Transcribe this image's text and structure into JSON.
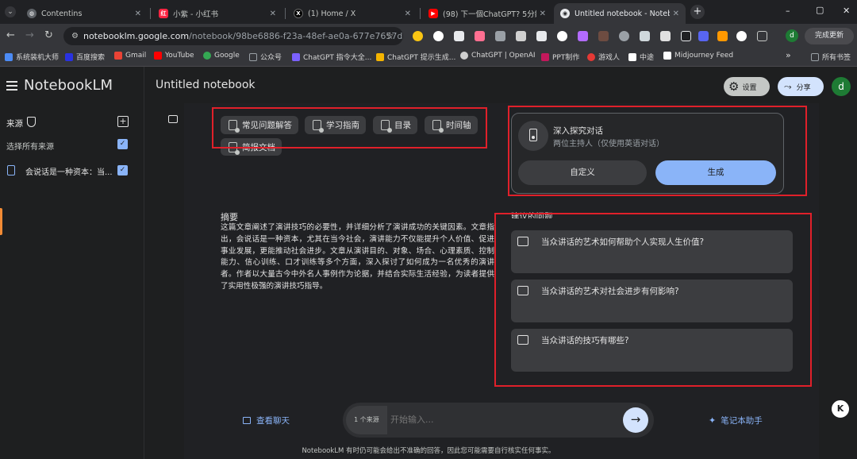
{
  "browser": {
    "tabs": [
      {
        "title": "Contentins",
        "fav": "C",
        "color": "#5f6368"
      },
      {
        "title": "小紫 - 小红书",
        "fav": "红",
        "color": "#ff2442"
      },
      {
        "title": "(1) Home / X",
        "fav": "X",
        "color": "#000000"
      },
      {
        "title": "(98) 下一個ChatGPT? 5分鐘自...",
        "fav": "▶",
        "color": "#ff0000"
      },
      {
        "title": "Untitled notebook - Noteboo",
        "fav": "N",
        "color": "#e8eaed"
      }
    ],
    "new_tab": "+",
    "window_controls": [
      "–",
      "▢",
      "✕"
    ],
    "url_host": "notebooklm.google.com",
    "url_path": "/notebook/98be6886-f23a-48ef-ae0a-677e7657ded...",
    "update_button": "完成更新",
    "profile_letter": "d",
    "bookmarks": [
      {
        "label": "系统装机大师",
        "color": "#4c8bf5"
      },
      {
        "label": "百度搜索",
        "color": "#2932e1"
      },
      {
        "label": "Gmail",
        "color": "#ea4335"
      },
      {
        "label": "YouTube",
        "color": "#ff0000"
      },
      {
        "label": "Google",
        "color": "#34a853"
      },
      {
        "label": "公众号",
        "color": "#9aa0a6"
      },
      {
        "label": "ChatGPT 指令大全...",
        "color": "#7b61ff"
      },
      {
        "label": "ChatGPT 提示生成...",
        "color": "#f4b400"
      },
      {
        "label": "ChatGPT | OpenAI",
        "color": "#cfcfcf"
      },
      {
        "label": "PPT制作",
        "color": "#c2185b"
      },
      {
        "label": "游戏人",
        "color": "#e53935"
      },
      {
        "label": "中途",
        "color": "#ffffff"
      },
      {
        "label": "Midjourney Feed",
        "color": "#ffffff"
      }
    ],
    "more_bookmarks": "»",
    "all_bookmarks": "所有书签"
  },
  "app": {
    "brand": "NotebookLM",
    "notebook_title": "Untitled notebook",
    "settings_label": "设置",
    "share_label": "分享",
    "avatar_letter": "d"
  },
  "sidebar": {
    "sources_title": "来源",
    "select_all": "选择所有来源",
    "source_item": "会说话是一种资本：当..."
  },
  "guide": {
    "chips": [
      "常见问题解答",
      "学习指南",
      "目录",
      "时间轴",
      "简报文档"
    ],
    "summary_title": "摘要",
    "summary_text": "这篇文章阐述了演讲技巧的必要性，并详细分析了演讲成功的关键因素。文章指出，会说话是一种资本，尤其在当今社会，演讲能力不仅能提升个人价值、促进事业发展，更能推动社会进步。文章从演讲目的、对象、场合、心理素质、控制能力、信心训练、口才训练等多个方面，深入探讨了如何成为一名优秀的演讲者。作者以大量古今中外名人事例作为论据，并结合实际生活经验，为读者提供了实用性极强的演讲技巧指导。"
  },
  "audio": {
    "title": "深入探究对话",
    "subtitle": "两位主持人（仅使用英语对话）",
    "customize": "自定义",
    "generate": "生成"
  },
  "suggested": {
    "title": "建议的问题",
    "questions": [
      "当众讲话的艺术如何帮助个人实现人生价值?",
      "当众讲话的艺术对社会进步有何影响?",
      "当众讲话的技巧有哪些?"
    ]
  },
  "bottom": {
    "view_chat": "查看聊天",
    "source_count": "1 个来源",
    "input_placeholder": "开始输入...",
    "notebook_helper": "笔记本助手",
    "disclaimer": "NotebookLM 有时仍可能会给出不准确的回答，因此您可能需要自行核实任何事实。"
  },
  "colors": {
    "accent": "#8ab4f8",
    "highlight_box": "#e0202a",
    "chip_bg": "#3c3d40",
    "checkbox": "#8ab4f8"
  }
}
